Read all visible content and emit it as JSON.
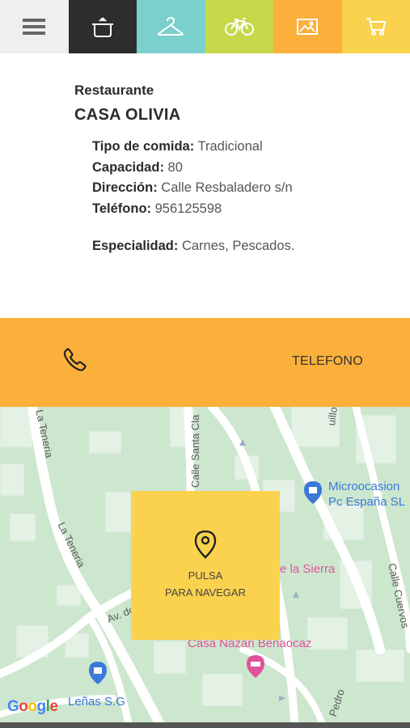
{
  "nav": {
    "items": [
      {
        "icon": "menu-icon",
        "color": "#efefef"
      },
      {
        "icon": "pot-icon",
        "color": "#2d2d2d"
      },
      {
        "icon": "hanger-icon",
        "color": "#7bcfcc"
      },
      {
        "icon": "bicycle-icon",
        "color": "#c5d94a"
      },
      {
        "icon": "image-icon",
        "color": "#fbb03b"
      },
      {
        "icon": "cart-icon",
        "color": "#fbd24e"
      }
    ]
  },
  "place": {
    "category": "Restaurante",
    "name": "CASA OLIVIA",
    "details": [
      {
        "label": "Tipo de comida:",
        "value": "Tradicional"
      },
      {
        "label": "Capacidad:",
        "value": "80"
      },
      {
        "label": "Dirección:",
        "value": "Calle Resbaladero s/n"
      },
      {
        "label": "Teléfono:",
        "value": "956125598"
      }
    ],
    "specialty": {
      "label": "Especialidad:",
      "value": "Carnes, Pescados."
    }
  },
  "call": {
    "label": "TELEFONO",
    "color": "#fbb03b"
  },
  "map": {
    "streets": [
      "La Teneria",
      "La Teneria",
      "Calle Santa Cla",
      "Av. de",
      "Calle Cuervos",
      "Pedro",
      "uillo"
    ],
    "pois": [
      {
        "text": "Microocasion",
        "color": "#3b78d8"
      },
      {
        "text": "Pc España SL",
        "color": "#3b78d8"
      },
      {
        "text": "e la Sierra",
        "color": "#e0529a"
      },
      {
        "text": "Casa Nazari Benaocaz",
        "color": "#e0529a"
      },
      {
        "text": "Leñas S.G",
        "color": "#3b78d8"
      }
    ],
    "navigate_line1": "PULSA",
    "navigate_line2": "PARA NAVEGAR",
    "attribution": "Google"
  }
}
